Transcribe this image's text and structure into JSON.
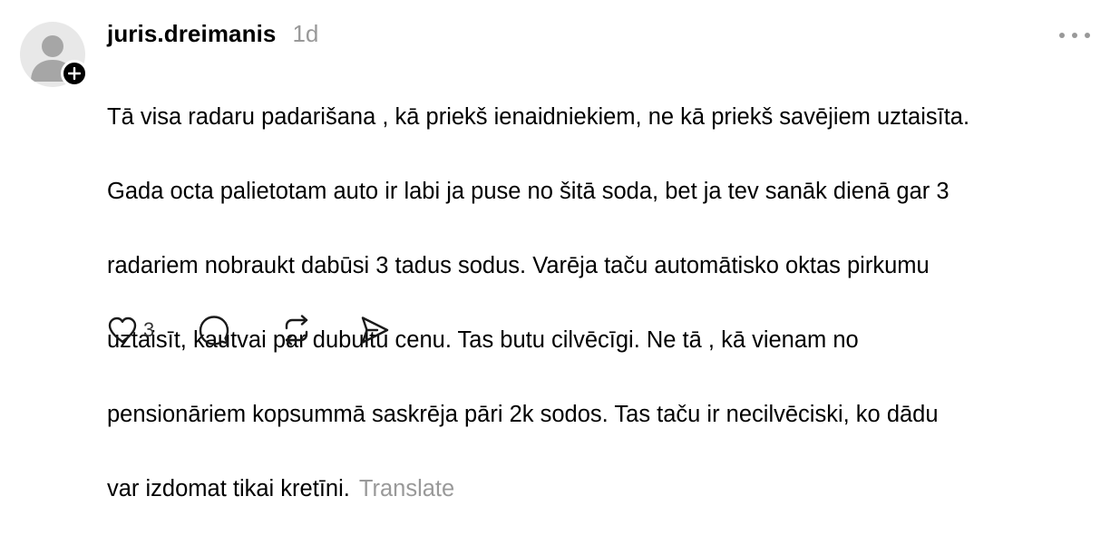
{
  "post": {
    "author": {
      "username": "juris.dreimanis",
      "avatar_icon": "default-user-avatar-icon",
      "follow_icon": "plus-icon"
    },
    "timestamp": "1d",
    "more_icon": "more-horizontal-icon",
    "body_lines": [
      "Tā visa radaru padarišana , kā priekš ienaidniekiem, ne kā priekš savējiem uztaisīta.",
      "Gada octa palietotam auto ir labi ja puse no šitā soda, bet ja tev sanāk dienā gar 3",
      "radariem nobraukt dabūsi 3 tadus sodus. Varēja taču automātisko oktas pirkumu",
      "uztaisīt, kautvai par dubultu cenu. Tas butu cilvēcīgi. Ne tā , kā vienam no",
      "pensionāriem kopsummā saskrēja pāri 2k sodos. Tas taču ir necilvēciski, ko dādu",
      "var izdomat tikai kretīni."
    ],
    "translate_label": "Translate",
    "actions": {
      "like": {
        "icon": "heart-icon",
        "count": "3"
      },
      "reply": {
        "icon": "comment-icon"
      },
      "repost": {
        "icon": "repost-icon"
      },
      "share": {
        "icon": "send-icon"
      }
    },
    "colors": {
      "text": "#000000",
      "muted": "#999999",
      "icon": "#1a1a1a",
      "avatar_bg": "#e8e8e8",
      "avatar_fg": "#a6a6a6"
    }
  }
}
